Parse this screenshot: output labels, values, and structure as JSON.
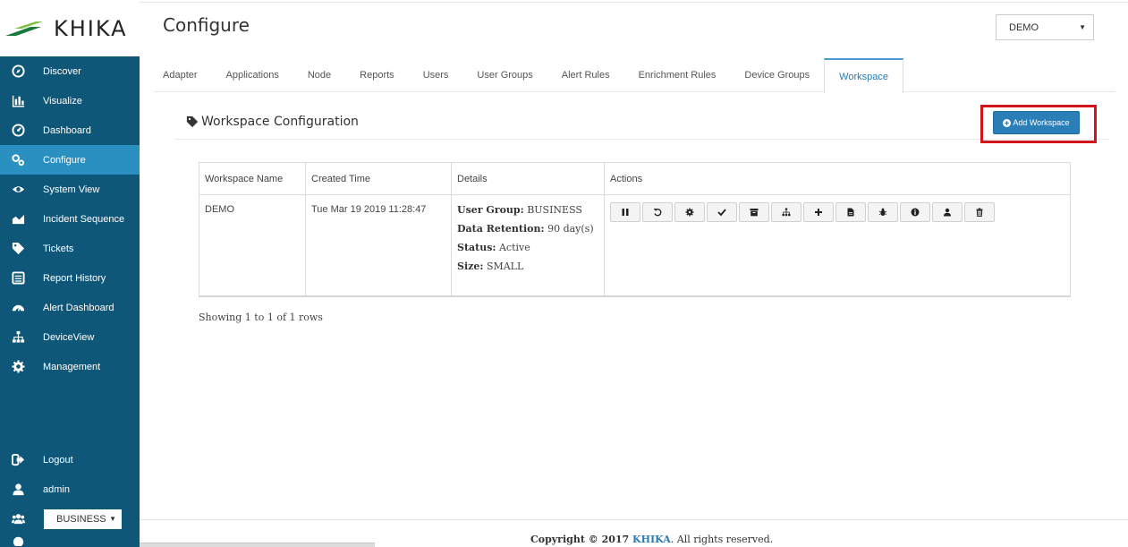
{
  "brand": {
    "name": "KHIKA",
    "accent": "#0f5779",
    "active": "#2a8fc1"
  },
  "header": {
    "title": "Configure",
    "workspace_select": "DEMO"
  },
  "sidebar": {
    "items": [
      {
        "label": "Discover",
        "icon": "compass-icon"
      },
      {
        "label": "Visualize",
        "icon": "bar-chart-icon"
      },
      {
        "label": "Dashboard",
        "icon": "dashboard-icon"
      },
      {
        "label": "Configure",
        "icon": "gears-icon"
      },
      {
        "label": "System View",
        "icon": "eye-icon"
      },
      {
        "label": "Incident Sequence",
        "icon": "area-chart-icon"
      },
      {
        "label": "Tickets",
        "icon": "tag-icon"
      },
      {
        "label": "Report History",
        "icon": "list-icon"
      },
      {
        "label": "Alert Dashboard",
        "icon": "tachometer-icon"
      },
      {
        "label": "DeviceView",
        "icon": "sitemap-icon"
      },
      {
        "label": "Management",
        "icon": "gear-icon"
      }
    ],
    "bottom": {
      "logout": "Logout",
      "user": "admin",
      "group_select": "BUSINESS"
    }
  },
  "tabs": [
    "Adapter",
    "Applications",
    "Node",
    "Reports",
    "Users",
    "User Groups",
    "Alert Rules",
    "Enrichment Rules",
    "Device Groups",
    "Workspace"
  ],
  "panel": {
    "title": "Workspace Configuration",
    "add_button": "Add Workspace"
  },
  "table": {
    "columns": [
      "Workspace Name",
      "Created Time",
      "Details",
      "Actions"
    ],
    "rows": [
      {
        "name": "DEMO",
        "created": "Tue Mar 19 2019 11:28:47",
        "details": {
          "user_group_label": "User Group:",
          "user_group": "BUSINESS",
          "retention_label": "Data Retention:",
          "retention": "90 day(s)",
          "status_label": "Status:",
          "status": "Active",
          "size_label": "Size:",
          "size": "SMALL"
        },
        "actions": [
          "pause-icon",
          "refresh-icon",
          "gear-icon",
          "check-icon",
          "archive-icon",
          "sitemap-icon",
          "plus-icon",
          "file-icon",
          "bug-icon",
          "info-icon",
          "user-icon",
          "trash-icon"
        ]
      }
    ]
  },
  "pagination": {
    "showing": "Showing 1 to 1 of 1 rows"
  },
  "footer": {
    "prefix": "Copyright © 2017",
    "brand": "KHIKA",
    "suffix": ". All rights reserved."
  }
}
